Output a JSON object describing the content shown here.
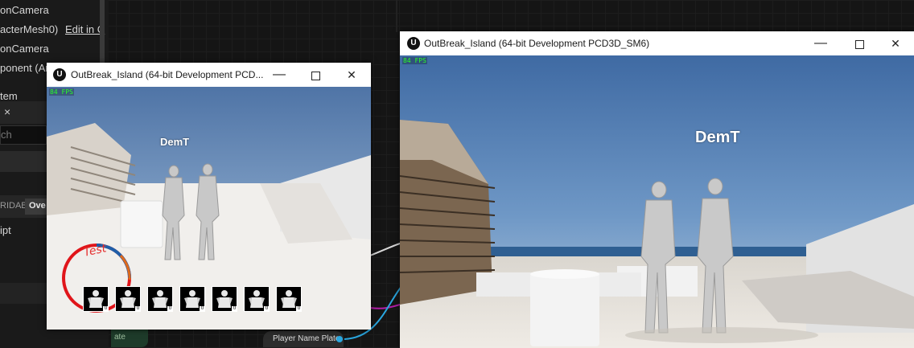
{
  "details_panel": {
    "row_1": "onCamera",
    "row_2": "acterMesh0)",
    "edit_link": "Edit in C",
    "row_3": "onCamera",
    "row_4": "ponent (Ar",
    "row_5": "tem",
    "search_placeholder": "ch",
    "override_label": "RIDABl",
    "override_button": "Ove",
    "script_label": "ipt",
    "close_glyph": "×"
  },
  "blueprint": {
    "node_left_label": "ate",
    "node_label": "Player Name Plate",
    "wire_colors": [
      "#2aa7e0",
      "#b21ea8",
      "#d8d8d8"
    ]
  },
  "small_window": {
    "title": "OutBreak_Island (64-bit Development PCD...",
    "fps": "84 FPS",
    "nameplate": "DemT",
    "hud_text": "Test",
    "slot_counts": [
      "0",
      "0",
      "0",
      "0",
      "0",
      "0",
      "0"
    ],
    "ring_colors": [
      "#e0151a",
      "#1f5ea8",
      "#e06a1a"
    ]
  },
  "large_window": {
    "title": "OutBreak_Island (64-bit Development PCD3D_SM6)",
    "fps": "84 FPS",
    "nameplate": "DemT"
  },
  "window_controls": {
    "minimize": "—",
    "close": "✕"
  }
}
